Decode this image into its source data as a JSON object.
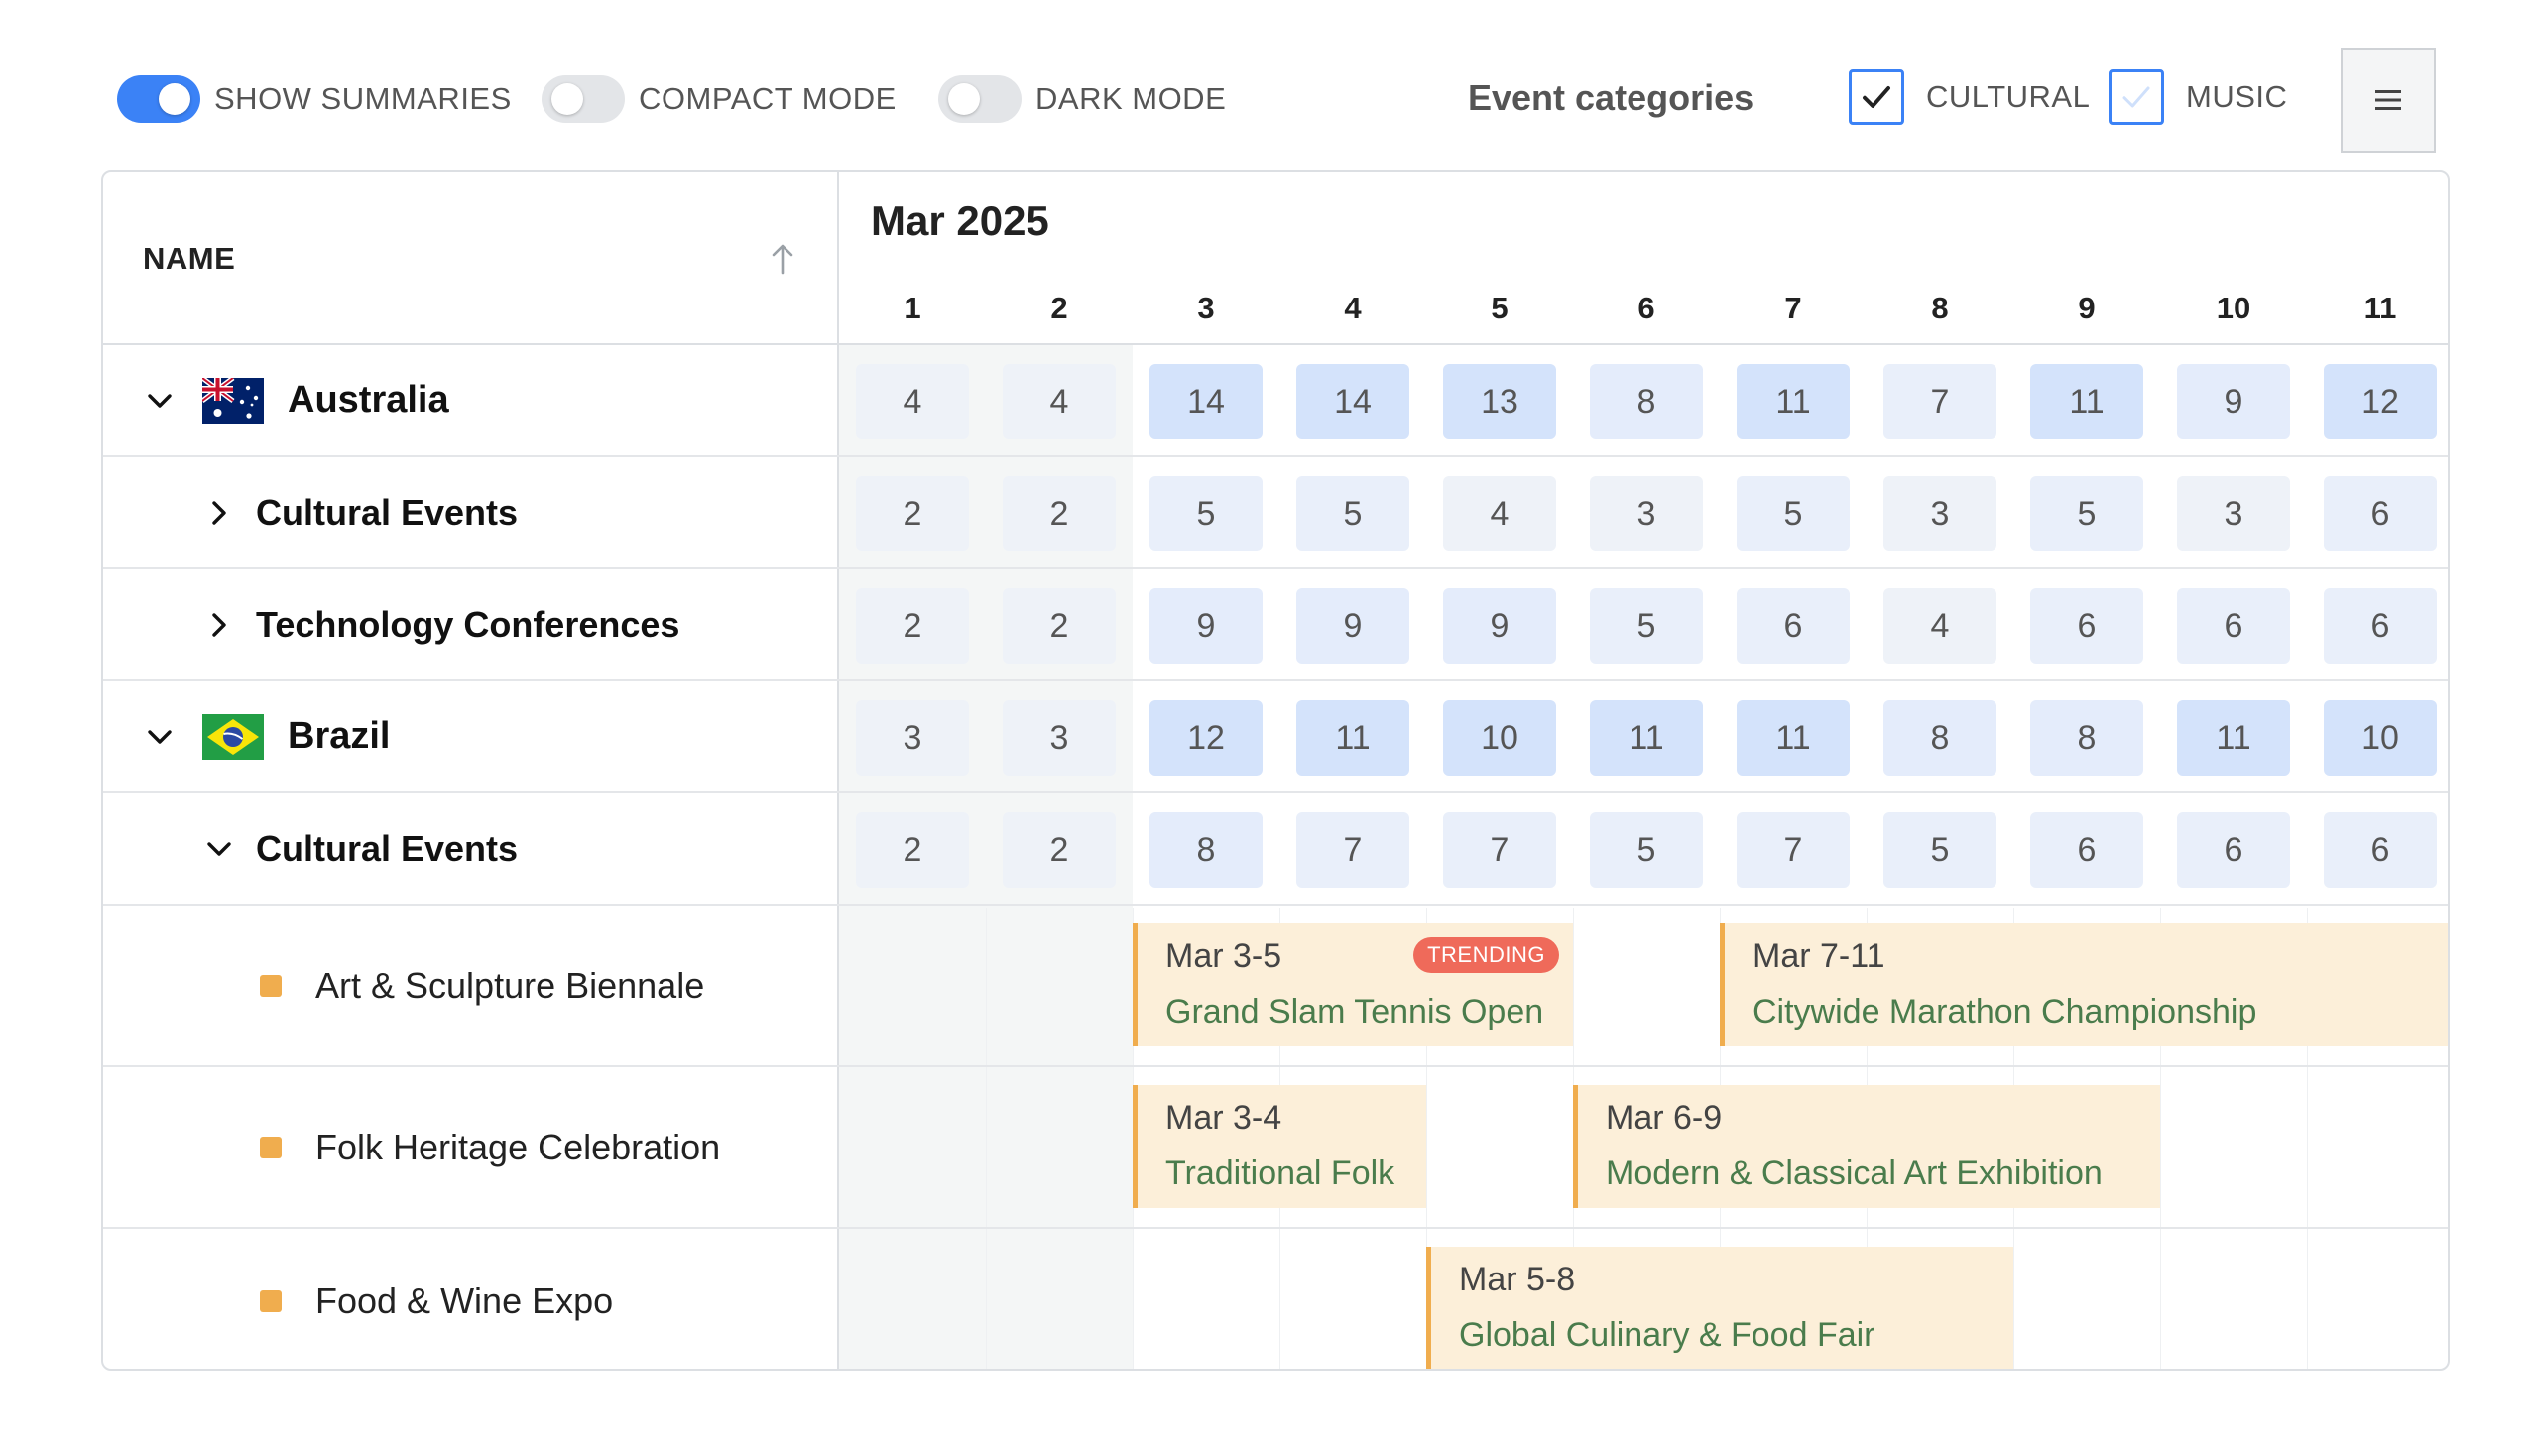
{
  "toolbar": {
    "toggles": [
      {
        "label": "SHOW SUMMARIES",
        "on": true
      },
      {
        "label": "COMPACT MODE",
        "on": false
      },
      {
        "label": "DARK MODE",
        "on": false
      }
    ],
    "categories_title": "Event categories",
    "categories": [
      {
        "label": "CULTURAL",
        "checked": true
      },
      {
        "label": "MUSIC",
        "checked": false
      }
    ],
    "menu_icon": "hamburger-icon"
  },
  "grid": {
    "name_header": "NAME",
    "sort_icon": "arrow-up-icon",
    "month": "Mar 2025",
    "days": [
      "1",
      "2",
      "3",
      "4",
      "5",
      "6",
      "7",
      "8",
      "9",
      "10",
      "11"
    ],
    "rows": [
      {
        "type": "country",
        "label": "Australia",
        "flag": "australia-flag-icon",
        "expanded": true,
        "values": [
          "4",
          "4",
          "14",
          "14",
          "13",
          "8",
          "11",
          "7",
          "11",
          "9",
          "12"
        ]
      },
      {
        "type": "group",
        "label": "Cultural Events",
        "expanded": false,
        "values": [
          "2",
          "2",
          "5",
          "5",
          "4",
          "3",
          "5",
          "3",
          "5",
          "3",
          "6"
        ]
      },
      {
        "type": "group",
        "label": "Technology Conferences",
        "expanded": false,
        "values": [
          "2",
          "2",
          "9",
          "9",
          "9",
          "5",
          "6",
          "4",
          "6",
          "6",
          "6"
        ]
      },
      {
        "type": "country",
        "label": "Brazil",
        "flag": "brazil-flag-icon",
        "expanded": true,
        "values": [
          "3",
          "3",
          "12",
          "11",
          "10",
          "11",
          "11",
          "8",
          "8",
          "11",
          "10"
        ]
      },
      {
        "type": "group",
        "label": "Cultural Events",
        "expanded": true,
        "values": [
          "2",
          "2",
          "8",
          "7",
          "7",
          "5",
          "7",
          "5",
          "6",
          "6",
          "6"
        ]
      },
      {
        "type": "event",
        "label": "Art & Sculpture Biennale",
        "bars": [
          {
            "date": "Mar 3-5",
            "title": "Grand Slam Tennis Open",
            "badge": "TRENDING"
          },
          {
            "date": "Mar 7-11",
            "title": "Citywide Marathon Championship"
          }
        ]
      },
      {
        "type": "event",
        "label": "Folk Heritage Celebration",
        "bars": [
          {
            "date": "Mar 3-4",
            "title": "Traditional Folk"
          },
          {
            "date": "Mar 6-9",
            "title": "Modern & Classical Art Exhibition"
          }
        ]
      },
      {
        "type": "event",
        "label": "Food & Wine Expo",
        "bars": [
          {
            "date": "Mar 5-8",
            "title": "Global Culinary & Food Fair"
          }
        ]
      }
    ]
  },
  "colors": {
    "accent": "#3b82f6",
    "event_bar": "#fcefd9",
    "event_border": "#f0ad4e",
    "event_title": "#4a7c4c",
    "badge": "#ef6a5a",
    "cell_low": "#eef2f8",
    "cell_mid": "#e4ecfb",
    "cell_high": "#d4e3fb"
  }
}
